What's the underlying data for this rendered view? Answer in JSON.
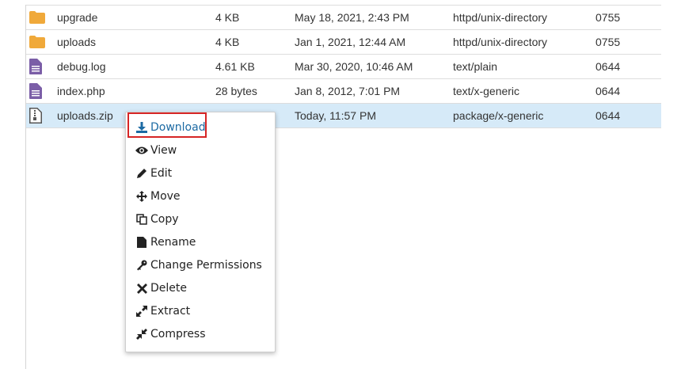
{
  "files": [
    {
      "name": "upgrade",
      "size": "4 KB",
      "modified": "May 18, 2021, 2:43 PM",
      "type": "httpd/unix-directory",
      "perms": "0755",
      "icon": "folder-icon"
    },
    {
      "name": "uploads",
      "size": "4 KB",
      "modified": "Jan 1, 2021, 12:44 AM",
      "type": "httpd/unix-directory",
      "perms": "0755",
      "icon": "folder-icon"
    },
    {
      "name": "debug.log",
      "size": "4.61 KB",
      "modified": "Mar 30, 2020, 10:46 AM",
      "type": "text/plain",
      "perms": "0644",
      "icon": "text-file-icon"
    },
    {
      "name": "index.php",
      "size": "28 bytes",
      "modified": "Jan 8, 2012, 7:01 PM",
      "type": "text/x-generic",
      "perms": "0644",
      "icon": "text-file-icon"
    },
    {
      "name": "uploads.zip",
      "size": "",
      "modified": "Today, 11:57 PM",
      "type": "package/x-generic",
      "perms": "0644",
      "icon": "zip-file-icon",
      "selected": true
    }
  ],
  "context_menu": {
    "items": [
      {
        "label": "Download",
        "icon": "download-icon"
      },
      {
        "label": "View",
        "icon": "eye-icon"
      },
      {
        "label": "Edit",
        "icon": "pencil-icon"
      },
      {
        "label": "Move",
        "icon": "move-arrows-icon"
      },
      {
        "label": "Copy",
        "icon": "copy-icon"
      },
      {
        "label": "Rename",
        "icon": "file-icon"
      },
      {
        "label": "Change Permissions",
        "icon": "key-icon"
      },
      {
        "label": "Delete",
        "icon": "x-icon"
      },
      {
        "label": "Extract",
        "icon": "expand-icon"
      },
      {
        "label": "Compress",
        "icon": "compress-icon"
      }
    ]
  },
  "colors": {
    "folder": "#f0a93a",
    "file": "#7b5ea7",
    "selected_row": "#d6eaf8",
    "download_text": "#1c6aa3",
    "highlight_border": "#d62525"
  }
}
